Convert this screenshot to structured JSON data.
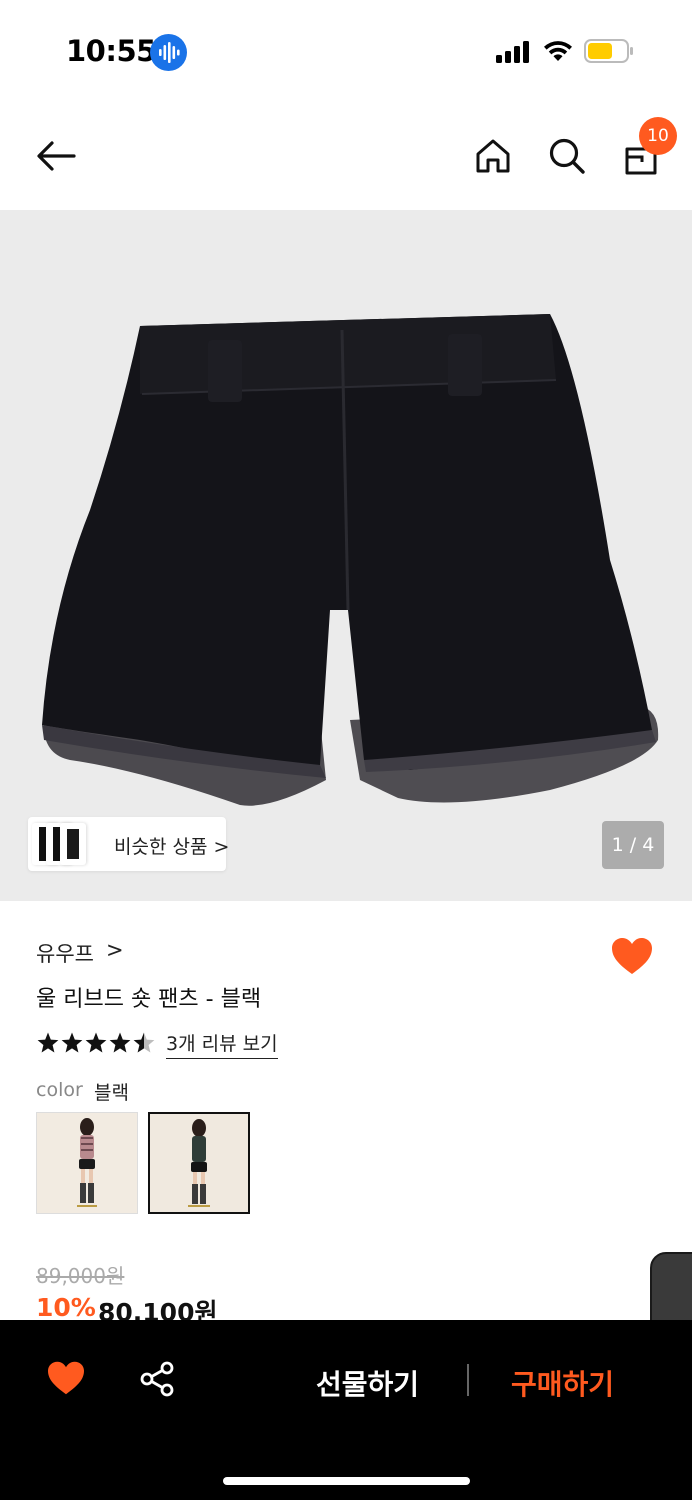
{
  "status_bar": {
    "time": "10:55",
    "icons": [
      "voice-memo-icon",
      "signal-icon",
      "wifi-icon",
      "battery-icon"
    ]
  },
  "nav": {
    "cart_count": "10",
    "icons": [
      "back-arrow-icon",
      "home-icon",
      "search-icon",
      "shopping-bag-icon"
    ]
  },
  "gallery": {
    "similar_label": "비슷한 상품 >",
    "page_indicator": "1 / 4"
  },
  "product": {
    "brand": "유우프",
    "brand_chevron": ">",
    "name": "울 리브드 숏 팬츠 - 블랙",
    "rating": 4.5,
    "review_link": "3개 리뷰 보기",
    "option_label": "color",
    "option_value": "블랙",
    "color_options": [
      "pink-striped-outfit",
      "black-outfit"
    ],
    "selected_option_index": 1,
    "original_price": "89,000원",
    "discount": "10%",
    "sale_price": "80,100원"
  },
  "bottom_bar": {
    "gift_label": "선물하기",
    "buy_label": "구매하기"
  },
  "side_handle": {
    "chevron": "<"
  },
  "colors": {
    "accent": "#ff5a1f",
    "bottom_bar_bg": "#000000",
    "image_bg": "#ebebeb"
  }
}
